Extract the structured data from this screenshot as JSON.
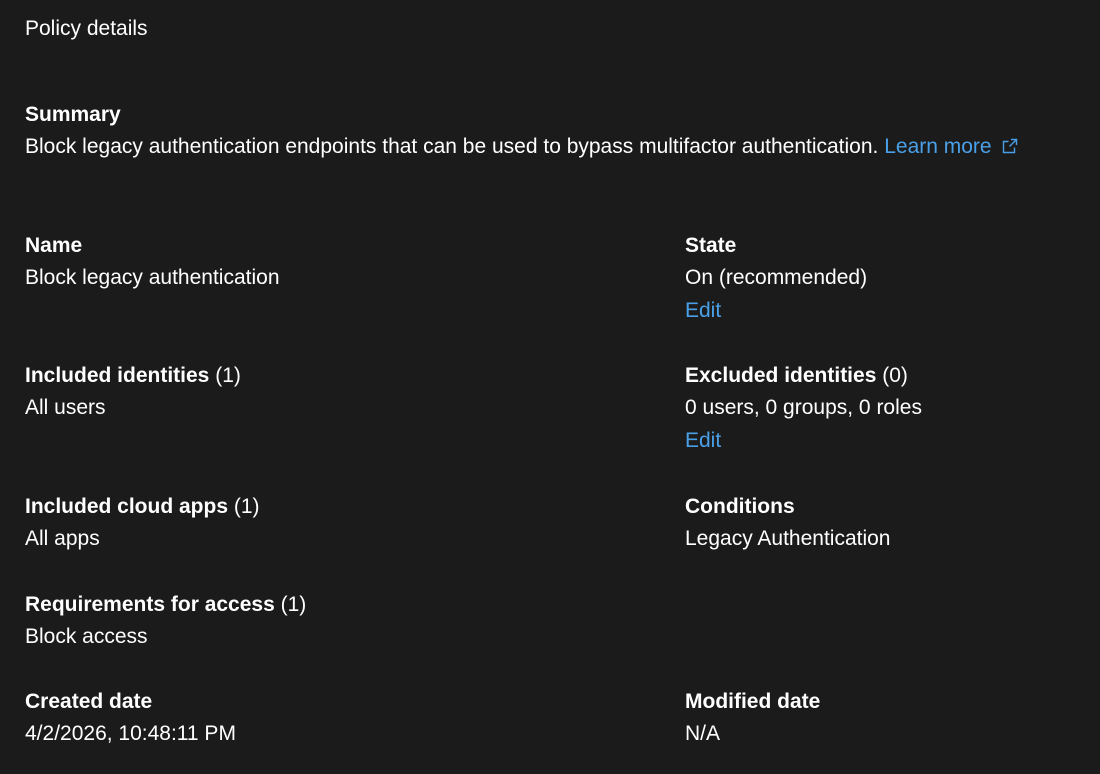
{
  "page": {
    "title": "Policy details"
  },
  "summary": {
    "label": "Summary",
    "text": "Block legacy authentication endpoints that can be used to bypass multifactor authentication.",
    "learn_more": "Learn more",
    "learn_more_icon": "external-link-icon"
  },
  "fields": {
    "name": {
      "label": "Name",
      "value": "Block legacy authentication"
    },
    "state": {
      "label": "State",
      "value": "On (recommended)",
      "edit": "Edit"
    },
    "included_identities": {
      "label": "Included identities",
      "count": "(1)",
      "value": "All users"
    },
    "excluded_identities": {
      "label": "Excluded identities",
      "count": "(0)",
      "value": "0 users, 0 groups, 0 roles",
      "edit": "Edit"
    },
    "included_cloud_apps": {
      "label": "Included cloud apps",
      "count": "(1)",
      "value": "All apps"
    },
    "conditions": {
      "label": "Conditions",
      "value": "Legacy Authentication"
    },
    "requirements": {
      "label": "Requirements for access",
      "count": "(1)",
      "value": "Block access"
    },
    "created_date": {
      "label": "Created date",
      "value": "4/2/2026, 10:48:11 PM"
    },
    "modified_date": {
      "label": "Modified date",
      "value": "N/A"
    }
  },
  "colors": {
    "background": "#1b1b1b",
    "text": "#ffffff",
    "link": "#4aa0e8"
  }
}
